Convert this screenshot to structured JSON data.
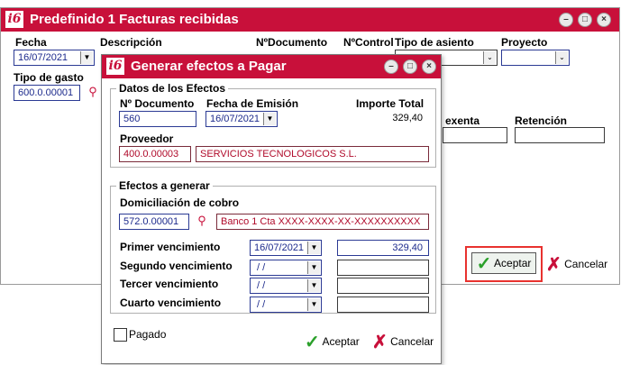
{
  "back_window": {
    "title": "Predefinido 1 Facturas recibidas",
    "logo": "i6",
    "labels": {
      "fecha": "Fecha",
      "descripcion": "Descripción",
      "documento": "NºDocumento",
      "control": "NºControl",
      "tipo_asiento": "Tipo de asiento",
      "proyecto": "Proyecto",
      "tipo_gasto": "Tipo de gasto",
      "exenta": "exenta",
      "retencion": "Retención"
    },
    "fecha_value": "16/07/2021",
    "tipo_gasto_value": "600.0.00001",
    "aceptar": "Aceptar",
    "cancelar": "Cancelar"
  },
  "dialog": {
    "title": "Generar efectos a Pagar",
    "logo": "i6",
    "datos": {
      "group_title": "Datos de los Efectos",
      "documento_label": "Nº Documento",
      "documento_value": "560",
      "fecha_label": "Fecha de Emisión",
      "fecha_value": "16/07/2021",
      "importe_label": "Importe Total",
      "importe_value": "329,40",
      "proveedor_label": "Proveedor",
      "proveedor_code": "400.0.00003",
      "proveedor_name": "SERVICIOS TECNOLOGICOS S.L."
    },
    "efectos": {
      "group_title": "Efectos a generar",
      "domiciliacion_label": "Domiciliación de cobro",
      "domiciliacion_code": "572.0.00001",
      "domiciliacion_name": "Banco 1 Cta XXXX-XXXX-XX-XXXXXXXXXX",
      "vencimientos": [
        {
          "label": "Primer vencimiento",
          "date": "16/07/2021",
          "amount": "329,40"
        },
        {
          "label": "Segundo vencimiento",
          "date": " / /",
          "amount": ""
        },
        {
          "label": "Tercer vencimiento",
          "date": " / /",
          "amount": ""
        },
        {
          "label": "Cuarto vencimiento",
          "date": " / /",
          "amount": ""
        }
      ]
    },
    "pagado_label": "Pagado",
    "aceptar": "Aceptar",
    "cancelar": "Cancelar"
  },
  "colors": {
    "accent": "#c8103a",
    "field_blue": "#1c2a8c",
    "field_red": "#b00a2a"
  }
}
